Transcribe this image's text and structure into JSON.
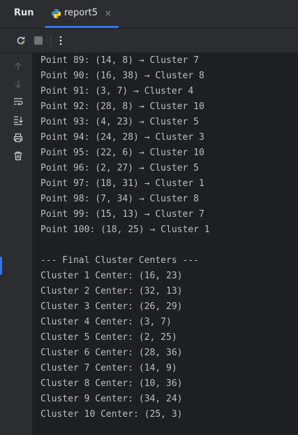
{
  "tabbar": {
    "run_label": "Run",
    "tab": {
      "label": "report5",
      "close": "×",
      "icon": "python-icon"
    }
  },
  "toolbar": {
    "buttons": [
      {
        "name": "rerun-icon",
        "color": "#6fba5b"
      },
      {
        "name": "stop-icon",
        "color": "#6f737a"
      },
      {
        "name": "more-options-icon",
        "color": "#dfe1e5"
      }
    ]
  },
  "sidebar": {
    "buttons": [
      "up-arrow-icon",
      "down-arrow-icon",
      "soft-wrap-icon",
      "scroll-to-end-icon",
      "print-icon",
      "trash-icon"
    ]
  },
  "console": {
    "lines": [
      "Point 89: (14, 8) → Cluster 7",
      "Point 90: (16, 38) → Cluster 8",
      "Point 91: (3, 7) → Cluster 4",
      "Point 92: (28, 8) → Cluster 10",
      "Point 93: (4, 23) → Cluster 5",
      "Point 94: (24, 28) → Cluster 3",
      "Point 95: (22, 6) → Cluster 10",
      "Point 96: (2, 27) → Cluster 5",
      "Point 97: (18, 31) → Cluster 1",
      "Point 98: (7, 34) → Cluster 8",
      "Point 99: (15, 13) → Cluster 7",
      "Point 100: (18, 25) → Cluster 1",
      "",
      "--- Final Cluster Centers ---",
      "Cluster 1 Center: (16, 23)",
      "Cluster 2 Center: (32, 13)",
      "Cluster 3 Center: (26, 29)",
      "Cluster 4 Center: (3, 7)",
      "Cluster 5 Center: (2, 25)",
      "Cluster 6 Center: (28, 36)",
      "Cluster 7 Center: (14, 9)",
      "Cluster 8 Center: (10, 36)",
      "Cluster 9 Center: (34, 24)",
      "Cluster 10 Center: (25, 3)"
    ]
  },
  "colors": {
    "accent": "#3574f0",
    "panel": "#2b2d30",
    "console_bg": "#1e1f22",
    "text": "#bcbec4"
  }
}
